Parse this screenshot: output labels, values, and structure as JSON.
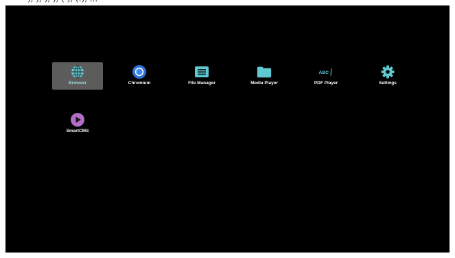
{
  "top_fragment": "),  ),  ),  ),  (  ),  (.),  ...",
  "colors": {
    "background": "#000000",
    "selection": "#5c5c5c",
    "teal_icon": "#5fc8d0",
    "chromium_blue": "#2f6fd6",
    "smartcms_purple": "#b36cc8"
  },
  "apps": [
    {
      "label": "Browser",
      "icon": "globe-icon",
      "selected": true
    },
    {
      "label": "Chromium",
      "icon": "chromium-icon",
      "selected": false
    },
    {
      "label": "File Manager",
      "icon": "file-manager-icon",
      "selected": false
    },
    {
      "label": "Media Player",
      "icon": "folder-icon",
      "selected": false
    },
    {
      "label": "PDF Player",
      "icon": "abc-text-icon",
      "selected": false
    },
    {
      "label": "Settings",
      "icon": "gear-icon",
      "selected": false
    },
    {
      "label": "SmartCMS",
      "icon": "play-icon",
      "selected": false
    }
  ],
  "pdf_icon_text": "ABC"
}
